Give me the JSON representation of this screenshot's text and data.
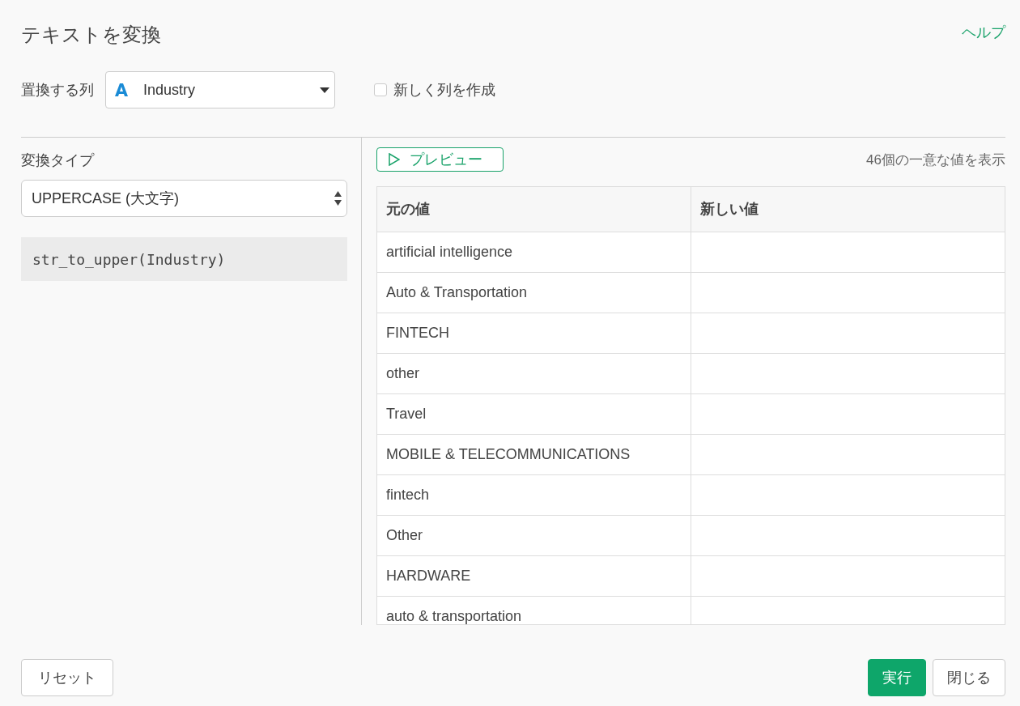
{
  "dialog": {
    "title": "テキストを変換",
    "help_link": "ヘルプ"
  },
  "column_select": {
    "label": "置換する列",
    "value": "Industry",
    "kind": "text"
  },
  "new_column": {
    "label": "新しく列を作成",
    "checked": false
  },
  "conversion": {
    "label": "変換タイプ",
    "value": "UPPERCASE (大文字)",
    "code": "str_to_upper(Industry)"
  },
  "preview": {
    "button": "プレビュー",
    "summary": "46個の一意な値を表示"
  },
  "table": {
    "columns": [
      "元の値",
      "新しい値"
    ],
    "rows": [
      [
        "artificial intelligence",
        ""
      ],
      [
        "Auto & Transportation",
        ""
      ],
      [
        "FINTECH",
        ""
      ],
      [
        "other",
        ""
      ],
      [
        "Travel",
        ""
      ],
      [
        "MOBILE & TELECOMMUNICATIONS",
        ""
      ],
      [
        "fintech",
        ""
      ],
      [
        "Other",
        ""
      ],
      [
        "HARDWARE",
        ""
      ],
      [
        "auto & transportation",
        ""
      ]
    ]
  },
  "footer": {
    "reset": "リセット",
    "run": "実行",
    "close": "閉じる"
  }
}
